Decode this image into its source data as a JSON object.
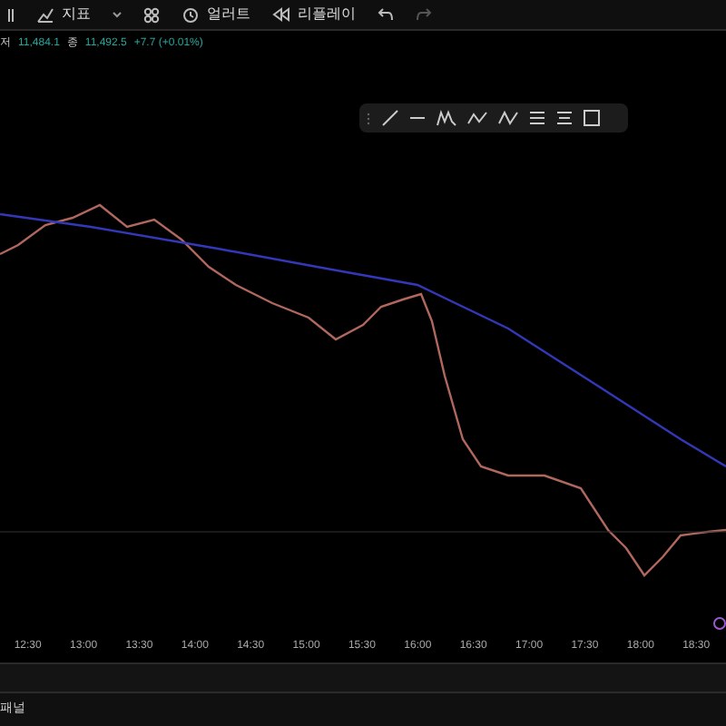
{
  "toolbar": {
    "items": [
      {
        "kind": "indicators",
        "label": "지표"
      },
      {
        "kind": "layout"
      },
      {
        "kind": "alert",
        "label": "얼러트"
      },
      {
        "kind": "replay",
        "label": "리플레이"
      }
    ]
  },
  "legend": {
    "low_label": "저",
    "low": "11,484.1",
    "close_label": "종",
    "close": "11,492.5",
    "change": "+7.7 (+0.01%)"
  },
  "time_axis": [
    "12:30",
    "13:00",
    "13:30",
    "14:00",
    "14:30",
    "15:00",
    "15:30",
    "16:00",
    "16:30",
    "17:00",
    "17:30",
    "18:00",
    "18:30"
  ],
  "bottom_panel": {
    "title": "패널"
  }
}
